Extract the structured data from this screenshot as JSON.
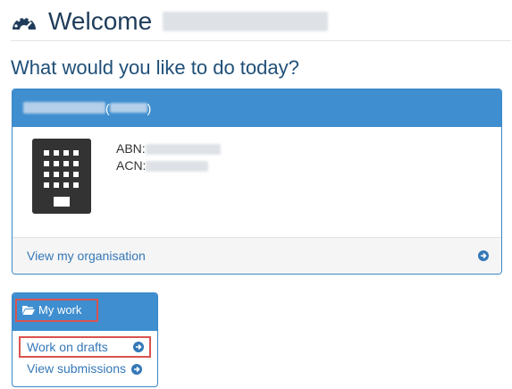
{
  "header": {
    "welcome": "Welcome",
    "icon": "dashboard-icon"
  },
  "main": {
    "question": "What would you like to do today?"
  },
  "org_panel": {
    "name_open_paren": "(",
    "name_close_paren": ")",
    "abn_label": "ABN:",
    "acn_label": "ACN:",
    "footer_link": "View my organisation"
  },
  "work_panel": {
    "title": "My work",
    "links": [
      "Work on drafts",
      "View submissions"
    ]
  },
  "colors": {
    "panel_header": "#3e8ed0",
    "link": "#3478b8",
    "highlight": "#d9534f"
  }
}
